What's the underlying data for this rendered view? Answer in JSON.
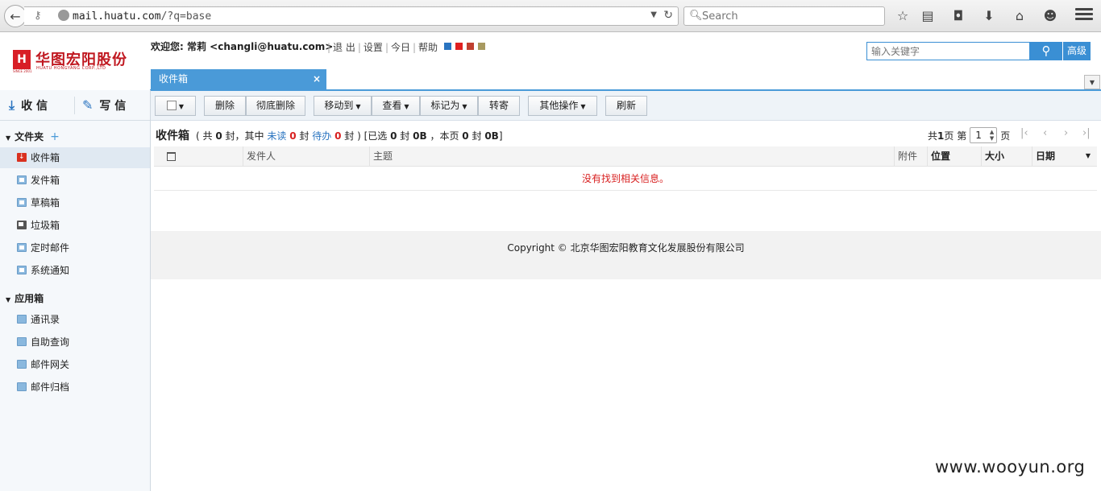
{
  "browser": {
    "url_host": "mail.huatu.com",
    "url_path": "/?q=base",
    "search_placeholder": "Search"
  },
  "header": {
    "logo_text": "华图宏阳股份",
    "logo_en": "HUATU HONGYANG CORP.,LTD",
    "logo_year": "SINCE 2001",
    "welcome": "欢迎您: 常莉 <changli@huatu.com>",
    "links": [
      "退 出",
      "设置",
      "今日",
      "帮助"
    ],
    "skin_colors": [
      "#2a74c0",
      "#e02020",
      "#c04030",
      "#a89a60"
    ],
    "search_placeholder": "输入关键字",
    "advanced_label": "高级"
  },
  "tabs": [
    {
      "label": "收件箱"
    }
  ],
  "sidebar": {
    "receive_label": "收 信",
    "write_label": "写 信",
    "folders_title": "文件夹",
    "folders": [
      {
        "label": "收件箱",
        "icon": "inbox-icon"
      },
      {
        "label": "发件箱",
        "icon": "folder-icon"
      },
      {
        "label": "草稿箱",
        "icon": "folder-icon"
      },
      {
        "label": "垃圾箱",
        "icon": "trash-icon"
      },
      {
        "label": "定时邮件",
        "icon": "folder-icon"
      },
      {
        "label": "系统通知",
        "icon": "folder-icon"
      }
    ],
    "apps_title": "应用箱",
    "apps": [
      {
        "label": "通讯录"
      },
      {
        "label": "自助查询"
      },
      {
        "label": "邮件网关"
      },
      {
        "label": "邮件归档"
      }
    ]
  },
  "toolbar": {
    "delete": "删除",
    "delete_permanent": "彻底删除",
    "move_to": "移动到",
    "view": "查看",
    "mark_as": "标记为",
    "forward": "转寄",
    "other_actions": "其他操作",
    "refresh": "刷新"
  },
  "summary": {
    "title": "收件箱",
    "p1": "( 共",
    "total": "0",
    "p2": "封，其中",
    "unread_label": "未读",
    "unread": "0",
    "p3": "封",
    "todo_label": "待办",
    "todo": "0",
    "p4": "封 ) [已选",
    "selected": "0",
    "p5": "封",
    "selected_size": "0B",
    "p6": "，本页",
    "page_count": "0",
    "p7": "封",
    "page_size": "0B",
    "p8": "]"
  },
  "pager": {
    "total_prefix": "共",
    "total_pages": "1",
    "total_suffix": "页 第",
    "current": "1",
    "page_suffix": "页"
  },
  "table": {
    "columns": [
      "发件人",
      "主题",
      "附件",
      "位置",
      "大小",
      "日期"
    ],
    "empty_message": "没有找到相关信息。"
  },
  "footer": {
    "copyright": "Copyright © 北京华图宏阳教育文化发展股份有限公司"
  },
  "watermark": "www.wooyun.org"
}
